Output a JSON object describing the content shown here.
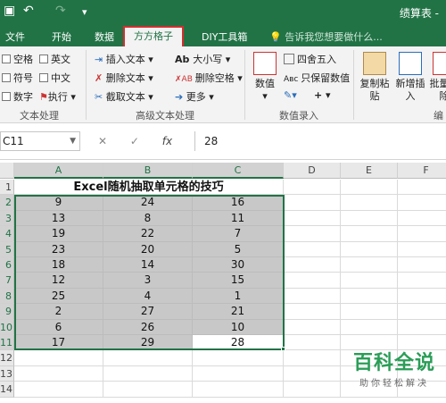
{
  "titlebar": {
    "undo_icon": "↶",
    "redo_icon": "↷",
    "customize_icon": "▾",
    "doc_title": "绩算表 -"
  },
  "tabs": [
    {
      "label": "文件"
    },
    {
      "label": "开始"
    },
    {
      "label": "数据"
    },
    {
      "label": "方方格子",
      "active": true
    },
    {
      "label": "DIY工具箱"
    }
  ],
  "tell_me": "告诉我您想要做什么...",
  "ribbon": {
    "text_group": {
      "label": "文本处理",
      "items": [
        "空格",
        "英文",
        "符号",
        "中文",
        "数字",
        "执行"
      ]
    },
    "advanced_group": {
      "label": "高级文本处理",
      "items": [
        "插入文本",
        "大小写",
        "删除文本",
        "删除空格",
        "截取文本",
        "更多"
      ]
    },
    "number_group": {
      "label": "数值录入",
      "numeric_label": "数值",
      "items": [
        "四舍五入",
        "只保留数值"
      ]
    },
    "edit_group": {
      "label": "编",
      "buttons": [
        "复制粘贴",
        "新增插入",
        "批量删除"
      ]
    }
  },
  "formula_bar": {
    "name_box": "C11",
    "cancel": "✕",
    "enter": "✓",
    "fx": "fx",
    "content": "28"
  },
  "sheet": {
    "columns": [
      "A",
      "B",
      "C",
      "D",
      "E",
      "F"
    ],
    "rows": [
      "1",
      "2",
      "3",
      "4",
      "5",
      "6",
      "7",
      "8",
      "9",
      "10",
      "11",
      "12",
      "13",
      "14"
    ],
    "title": "Excel随机抽取单元格的技巧",
    "data": [
      [
        "9",
        "24",
        "16"
      ],
      [
        "13",
        "8",
        "11"
      ],
      [
        "19",
        "22",
        "7"
      ],
      [
        "23",
        "20",
        "5"
      ],
      [
        "18",
        "14",
        "30"
      ],
      [
        "12",
        "3",
        "15"
      ],
      [
        "25",
        "4",
        "1"
      ],
      [
        "2",
        "27",
        "21"
      ],
      [
        "6",
        "26",
        "10"
      ],
      [
        "17",
        "29",
        "28"
      ]
    ]
  },
  "watermark": {
    "main": "百科全说",
    "sub": "助你轻松解决"
  },
  "colors": {
    "excel_green": "#217346",
    "selection_gray": "#c8c8c8",
    "tab_highlight": "#d32f2f"
  }
}
